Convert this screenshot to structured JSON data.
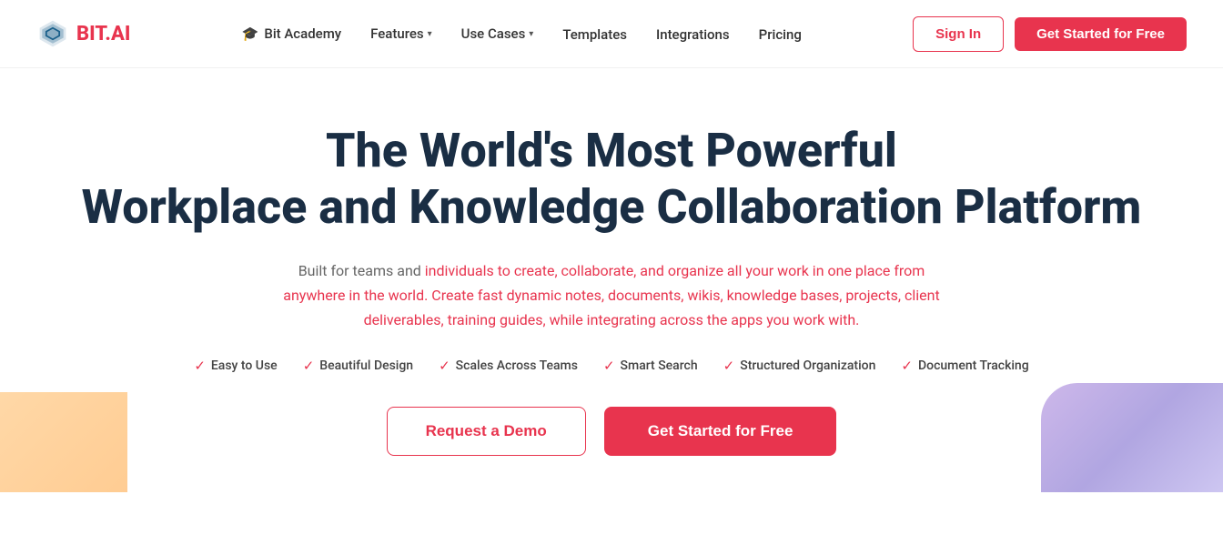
{
  "logo": {
    "text_bit": "BIT",
    "text_ai": ".AI"
  },
  "nav": {
    "academy_label": "Bit Academy",
    "features_label": "Features",
    "use_cases_label": "Use Cases",
    "templates_label": "Templates",
    "integrations_label": "Integrations",
    "pricing_label": "Pricing",
    "signin_label": "Sign In",
    "get_started_label": "Get Started for Free"
  },
  "hero": {
    "heading_line1": "The World's Most Powerful",
    "heading_line2": "Workplace and Knowledge Collaboration Platform",
    "description": "Built for teams and individuals to create, collaborate, and organize all your work in one place from anywhere in the world. Create fast dynamic notes, documents, wikis, knowledge bases, projects, client deliverables, training guides, while integrating across the apps you work with.",
    "features": [
      "Easy to Use",
      "Beautiful Design",
      "Scales Across Teams",
      "Smart Search",
      "Structured Organization",
      "Document Tracking"
    ],
    "btn_demo": "Request a Demo",
    "btn_cta": "Get Started for Free"
  },
  "colors": {
    "brand_red": "#e8344e",
    "brand_dark": "#1a2e44"
  }
}
